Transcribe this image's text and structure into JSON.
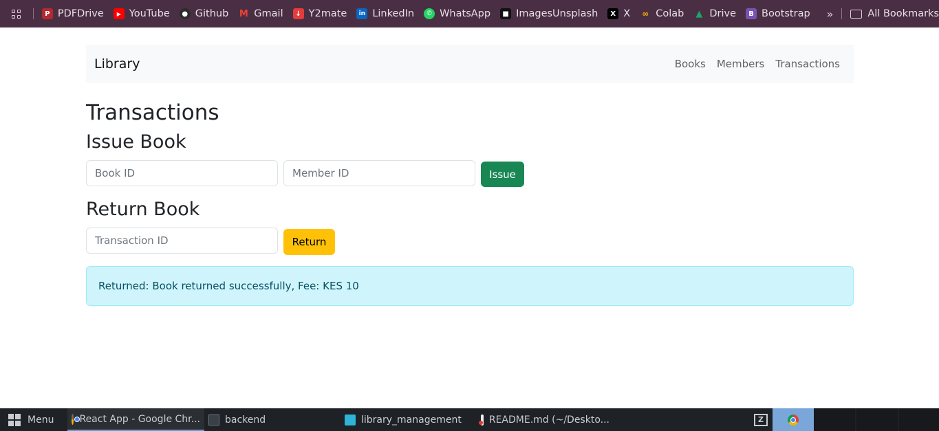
{
  "bookmarks": {
    "items": [
      {
        "label": "PDFDrive",
        "icon": "pdfdrive-icon",
        "color": "#b4282e"
      },
      {
        "label": "YouTube",
        "icon": "youtube-icon",
        "color": "#ff0000"
      },
      {
        "label": "Github",
        "icon": "github-icon",
        "color": "#2b2b2b"
      },
      {
        "label": "Gmail",
        "icon": "gmail-icon",
        "color": "#ea4335"
      },
      {
        "label": "Y2mate",
        "icon": "y2mate-icon",
        "color": "#e53b3b"
      },
      {
        "label": "LinkedIn",
        "icon": "linkedin-icon",
        "color": "#0a66c2"
      },
      {
        "label": "WhatsApp",
        "icon": "whatsapp-icon",
        "color": "#25d366"
      },
      {
        "label": "ImagesUnsplash",
        "icon": "unsplash-icon",
        "color": "#111111"
      },
      {
        "label": "X",
        "icon": "x-icon",
        "color": "#000000"
      },
      {
        "label": "Colab",
        "icon": "colab-icon",
        "color": "#f9ab00"
      },
      {
        "label": "Drive",
        "icon": "drive-icon",
        "color": "#1fa463"
      },
      {
        "label": "Bootstrap",
        "icon": "bootstrap-icon",
        "color": "#7952b3"
      }
    ],
    "more": "»",
    "all_bookmarks": "All Bookmarks"
  },
  "navbar": {
    "brand": "Library",
    "links": [
      "Books",
      "Members",
      "Transactions"
    ]
  },
  "page": {
    "title": "Transactions",
    "issue": {
      "heading": "Issue Book",
      "book_id_placeholder": "Book ID",
      "member_id_placeholder": "Member ID",
      "button": "Issue"
    },
    "return": {
      "heading": "Return Book",
      "transaction_id_placeholder": "Transaction ID",
      "button": "Return"
    },
    "alert": "Returned: Book returned successfully, Fee: KES 10"
  },
  "taskbar": {
    "menu": "Menu",
    "tasks": [
      {
        "label": "React App - Google Chr...",
        "icon": "chrome-icon"
      },
      {
        "label": "backend",
        "icon": "terminal-icon"
      },
      {
        "label": "library_management",
        "icon": "folder-icon"
      },
      {
        "label": "README.md (~/Deskto...",
        "icon": "text-editor-icon"
      }
    ]
  },
  "colors": {
    "bookmarks_bg": "#4a2f44",
    "issue_button": "#198754",
    "return_button": "#ffc107",
    "alert_bg": "#cff4fc",
    "taskbar_bg": "#1e2125"
  }
}
